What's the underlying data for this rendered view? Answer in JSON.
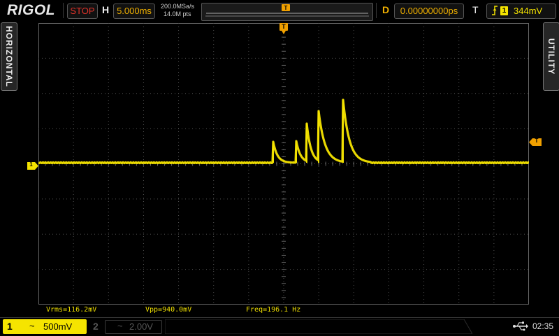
{
  "brand": "RIGOL",
  "status": "STOP",
  "horizontal": {
    "label": "H",
    "timebase": "5.000ms"
  },
  "acquisition": {
    "sample_rate": "200.0MSa/s",
    "memory_depth": "14.0M pts"
  },
  "delay": {
    "label": "D",
    "value": "0.00000000ps"
  },
  "trigger": {
    "label": "T",
    "channel": "1",
    "level": "344mV",
    "marker_label": "T"
  },
  "side_tabs": {
    "left": "HORIZONTAL",
    "right": "UTILITY"
  },
  "ch1_marker": "1",
  "measurements": {
    "vrms": "Vrms=116.2mV",
    "vpp": "Vpp=940.0mV",
    "freq": "Freq=196.1 Hz"
  },
  "channels": [
    {
      "number": "1",
      "coupling": "~",
      "scale": "500mV",
      "active": true
    },
    {
      "number": "2",
      "coupling": "~",
      "scale": "2.00V",
      "active": false
    }
  ],
  "clock": "02:35",
  "colors": {
    "ch1": "#f5e400",
    "accent": "#f0b000",
    "stop": "#e0332a"
  },
  "icons": {
    "usb": "usb-icon",
    "trigger_edge": "rising-edge-icon"
  }
}
